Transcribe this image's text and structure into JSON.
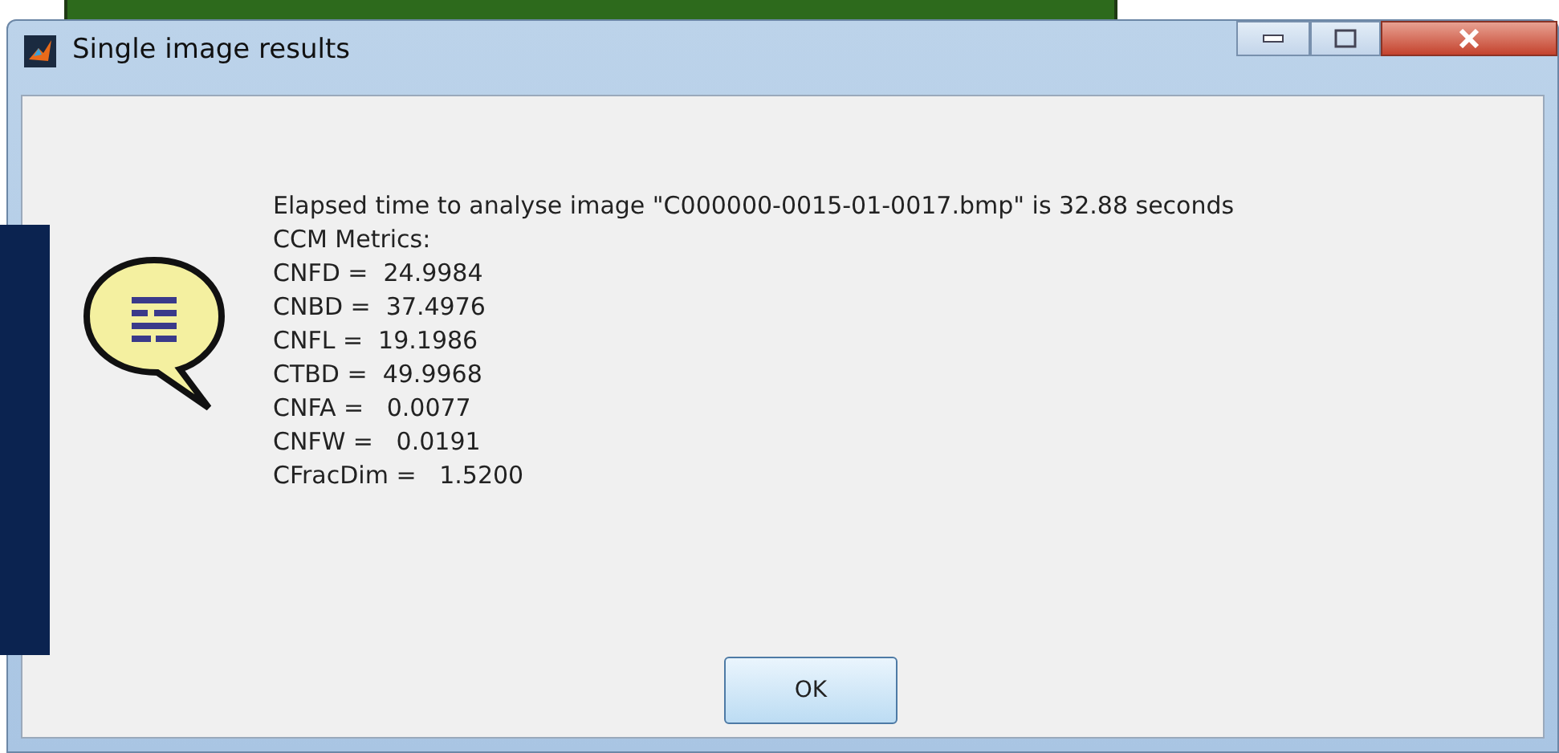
{
  "window": {
    "title": "Single image results"
  },
  "message": {
    "lines": [
      "Elapsed time to analyse image \"C000000-0015-01-0017.bmp\" is 32.88 seconds",
      "CCM Metrics:",
      "CNFD =  24.9984",
      "CNBD =  37.4976",
      "CNFL =  19.1986",
      "CTBD =  49.9968",
      "CNFA =   0.0077",
      "CNFW =   0.0191",
      "CFracDim =   1.5200"
    ]
  },
  "buttons": [
    {
      "label": "OK"
    }
  ]
}
